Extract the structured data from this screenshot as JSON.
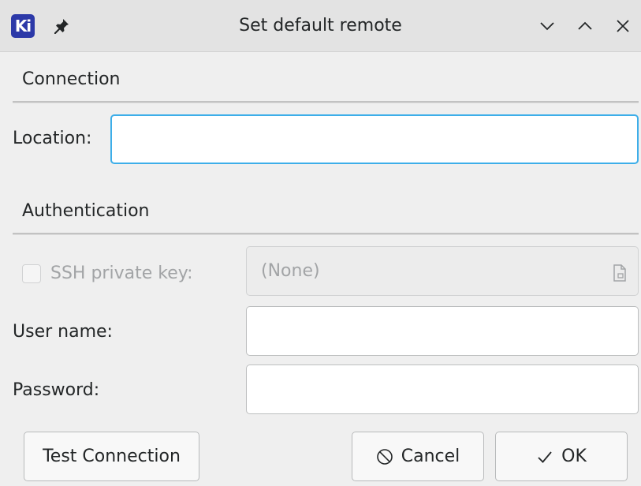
{
  "window": {
    "app_icon_text": "Ki",
    "title": "Set default remote"
  },
  "connection": {
    "section_title": "Connection",
    "location_label": "Location:",
    "location_value": ""
  },
  "authentication": {
    "section_title": "Authentication",
    "ssh_key_label": "SSH private key:",
    "ssh_key_checked": false,
    "ssh_key_value": "(None)",
    "username_label": "User name:",
    "username_value": "",
    "password_label": "Password:",
    "password_value": ""
  },
  "buttons": {
    "test_connection": "Test Connection",
    "cancel": "Cancel",
    "ok": "OK"
  },
  "icons": {
    "app": "kicad-logo-icon",
    "pin": "pin-icon",
    "minimize": "chevron-down-icon",
    "maximize": "chevron-up-icon",
    "close": "close-icon",
    "file_browse": "file-browse-icon",
    "cancel": "cancel-icon",
    "ok": "checkmark-icon"
  },
  "colors": {
    "focus_border": "#3daee9",
    "app_icon_bg": "#2c39a8",
    "disabled_text": "#a2a4a6"
  }
}
